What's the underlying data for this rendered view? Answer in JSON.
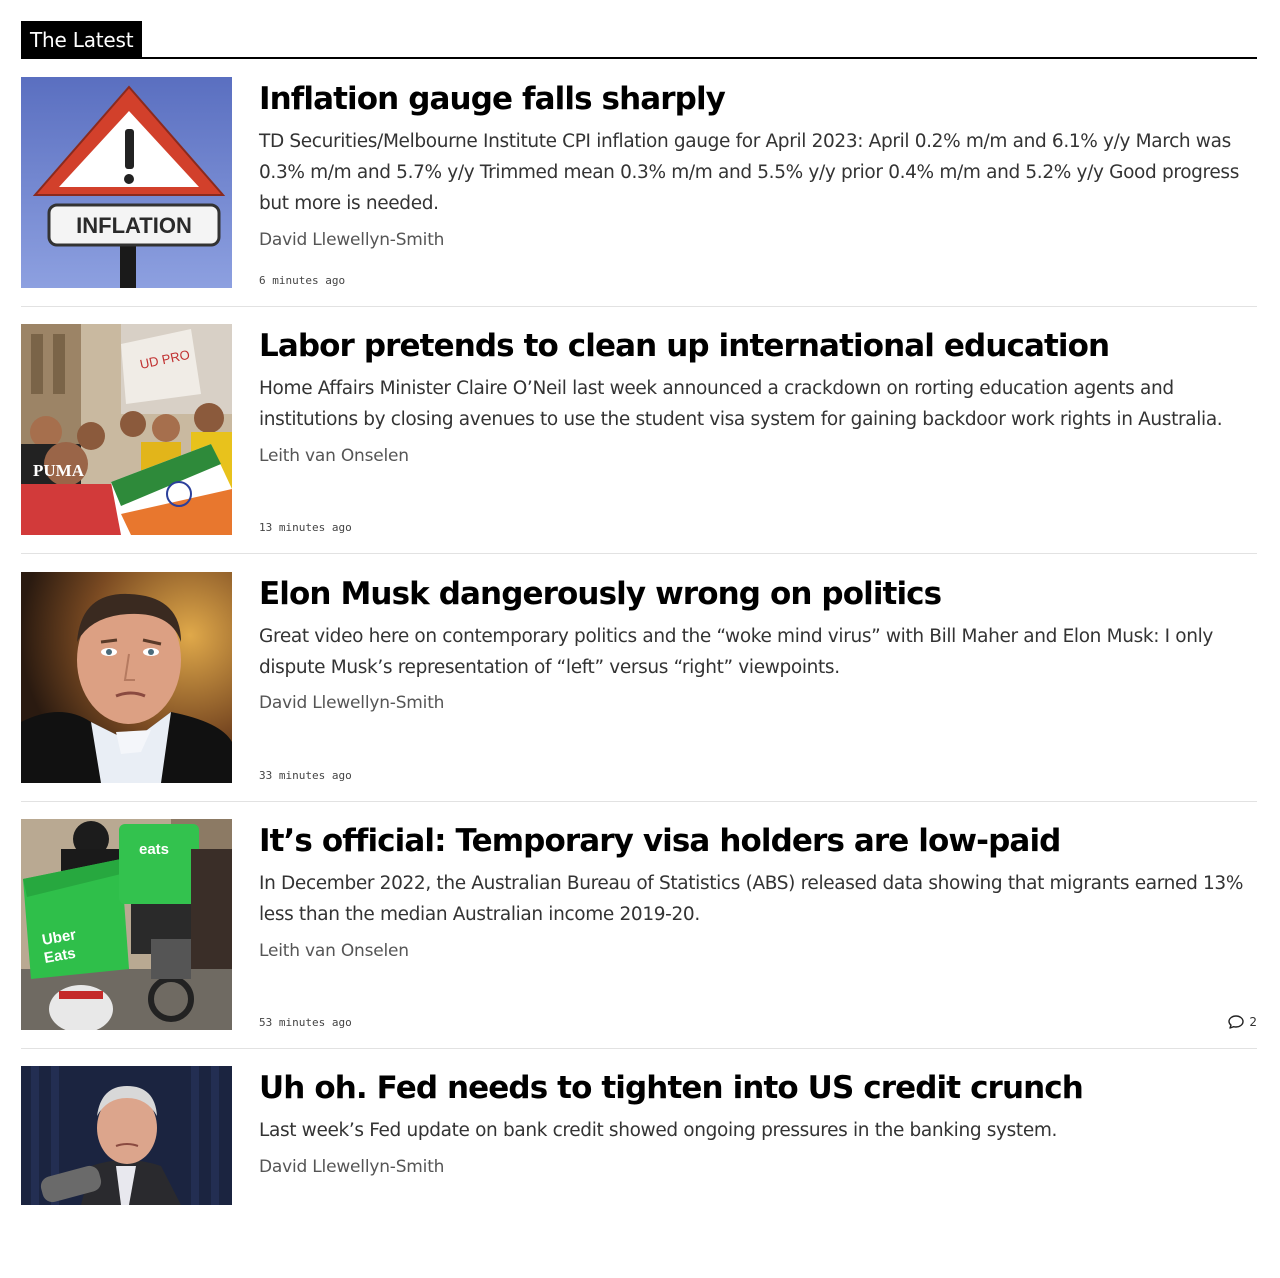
{
  "section": {
    "label": "The Latest"
  },
  "articles": [
    {
      "title": "Inflation gauge falls sharply",
      "excerpt": "TD Securities/Melbourne Institute CPI inflation gauge for April 2023: April 0.2% m/m and 6.1% y/y March was 0.3% m/m and 5.7% y/y Trimmed mean 0.3% m/m and 5.5% y/y prior 0.4% m/m and 5.2% y/y Good progress but more is needed.",
      "author": "David Llewellyn-Smith",
      "time": "6 minutes ago",
      "image_sign_text": "INFLATION"
    },
    {
      "title": "Labor pretends to clean up international education",
      "excerpt": "Home Affairs Minister Claire O’Neil last week announced a crackdown on rorting education agents and institutions by closing avenues to use the student visa system for gaining backdoor work rights in Australia.",
      "author": "Leith van Onselen",
      "time": "13 minutes ago",
      "image_shirt_text": "PUMA"
    },
    {
      "title": "Elon Musk dangerously wrong on politics",
      "excerpt": "Great video here on contemporary politics and the “woke mind virus” with Bill Maher and Elon Musk: I only dispute Musk’s representation of “left” versus “right” viewpoints.",
      "author": "David Llewellyn-Smith",
      "time": "33 minutes ago"
    },
    {
      "title": "It’s official: Temporary visa holders are low-paid",
      "excerpt": "In December 2022, the Australian Bureau of Statistics (ABS) released data showing that migrants earned 13% less than the median Australian income 2019-20.",
      "author": "Leith van Onselen",
      "time": "53 minutes ago",
      "comments": "2",
      "image_bag_text_1": "Uber",
      "image_bag_text_2": "Eats",
      "image_bag_text_3": "eats"
    },
    {
      "title": "Uh oh. Fed needs to tighten into US credit crunch",
      "excerpt": "Last week’s Fed update on bank credit showed ongoing pressures in the banking system.",
      "author": "David Llewellyn-Smith"
    }
  ],
  "colors": {
    "accent": "#000000",
    "divider": "#e2e2e2",
    "excerpt": "#333333",
    "author": "#555555"
  }
}
